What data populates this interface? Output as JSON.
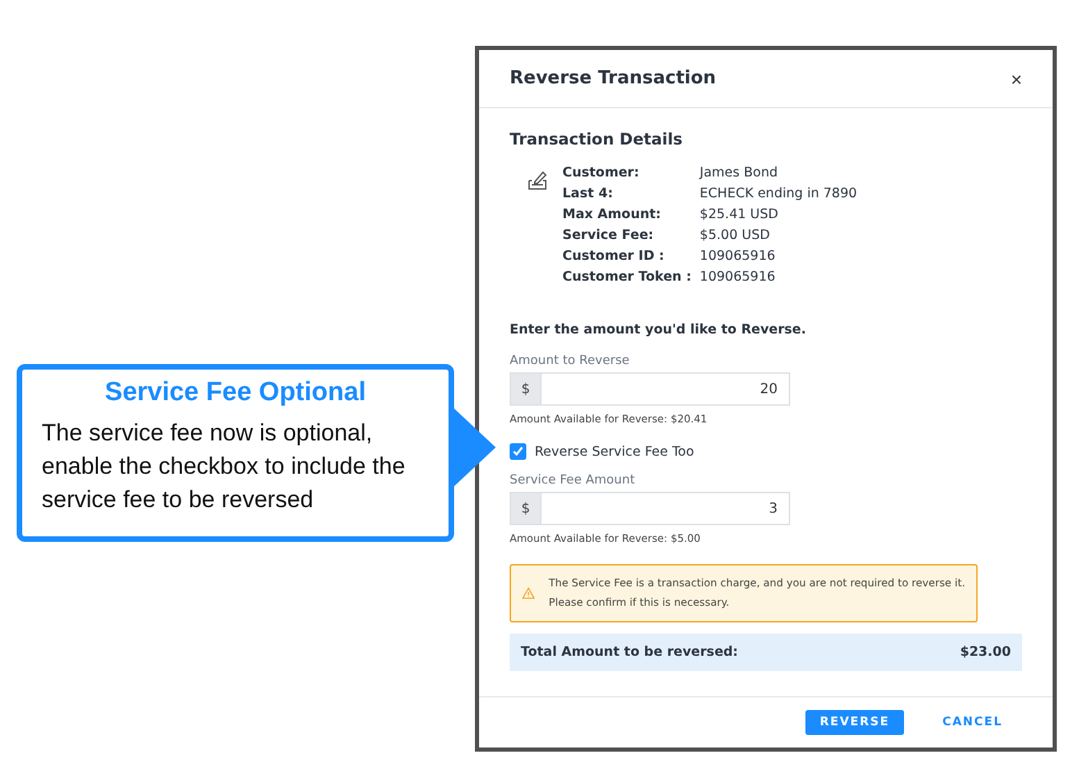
{
  "callout": {
    "title": "Service Fee Optional",
    "text": "The service fee now is optional, enable the checkbox to include the service fee to be reversed"
  },
  "dialog": {
    "title": "Reverse Transaction",
    "close": "×",
    "details_title": "Transaction Details",
    "details": [
      {
        "label": "Customer:",
        "value": "James Bond"
      },
      {
        "label": "Last 4:",
        "value": "ECHECK ending in 7890"
      },
      {
        "label": "Max Amount:",
        "value": "$25.41 USD"
      },
      {
        "label": "Service Fee:",
        "value": "$5.00 USD"
      },
      {
        "label": "Customer ID :",
        "value": "109065916"
      },
      {
        "label": "Customer Token :",
        "value": "109065916"
      }
    ],
    "prompt": "Enter the amount you'd like to Reverse.",
    "amount": {
      "label": "Amount to Reverse",
      "prefix": "$",
      "value": "20",
      "hint": "Amount Available for Reverse: $20.41"
    },
    "fee_checkbox": {
      "label": "Reverse Service Fee Too",
      "checked": true
    },
    "fee": {
      "label": "Service Fee Amount",
      "prefix": "$",
      "value": "3",
      "hint": "Amount Available for Reverse: $5.00"
    },
    "warning": {
      "lines": [
        "The Service Fee is a transaction charge, and you are not required to reverse it.",
        "Please confirm if this is necessary."
      ]
    },
    "total": {
      "label": "Total Amount to be reversed:",
      "value": "$23.00"
    },
    "buttons": [
      {
        "label": "REVERSE",
        "kind": "primary"
      },
      {
        "label": "CANCEL",
        "kind": "text"
      }
    ]
  }
}
